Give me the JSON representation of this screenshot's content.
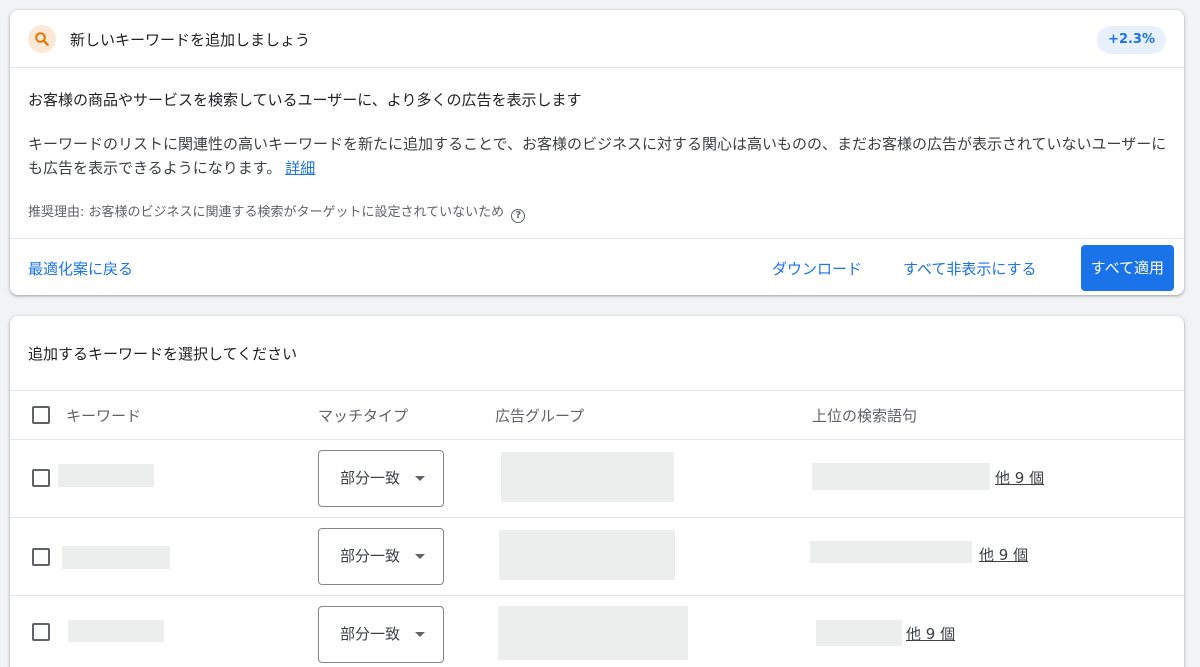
{
  "header": {
    "icon": "search-icon",
    "title": "新しいキーワードを追加しましょう",
    "badge": "+2.3%"
  },
  "description": {
    "lead": "お客様の商品やサービスを検索しているユーザーに、より多くの広告を表示します",
    "body": "キーワードのリストに関連性の高いキーワードを新たに追加することで、お客様のビジネスに対する関心は高いものの、まだお客様の広告が表示されていないユーザーにも広告を表示できるようになります。",
    "learn_more": "詳細",
    "reason": "推奨理由: お客様のビジネスに関連する検索がターゲットに設定されていないため"
  },
  "actions": {
    "back": "最適化案に戻る",
    "download": "ダウンロード",
    "dismiss_all": "すべて非表示にする",
    "apply_all": "すべて適用"
  },
  "keywords_section": {
    "title": "追加するキーワードを選択してください",
    "columns": [
      "キーワード",
      "マッチタイプ",
      "広告グループ",
      "上位の検索語句"
    ],
    "rows": [
      {
        "match_type": "部分一致",
        "more_terms": "他 9 個"
      },
      {
        "match_type": "部分一致",
        "more_terms": "他 9 個"
      },
      {
        "match_type": "部分一致",
        "more_terms": "他 9 個"
      }
    ]
  },
  "colors": {
    "accent": "#1a73e8",
    "badge_bg": "#e8f0fe",
    "search_icon": "#e37400",
    "search_icon_bg": "#fde8d7"
  }
}
